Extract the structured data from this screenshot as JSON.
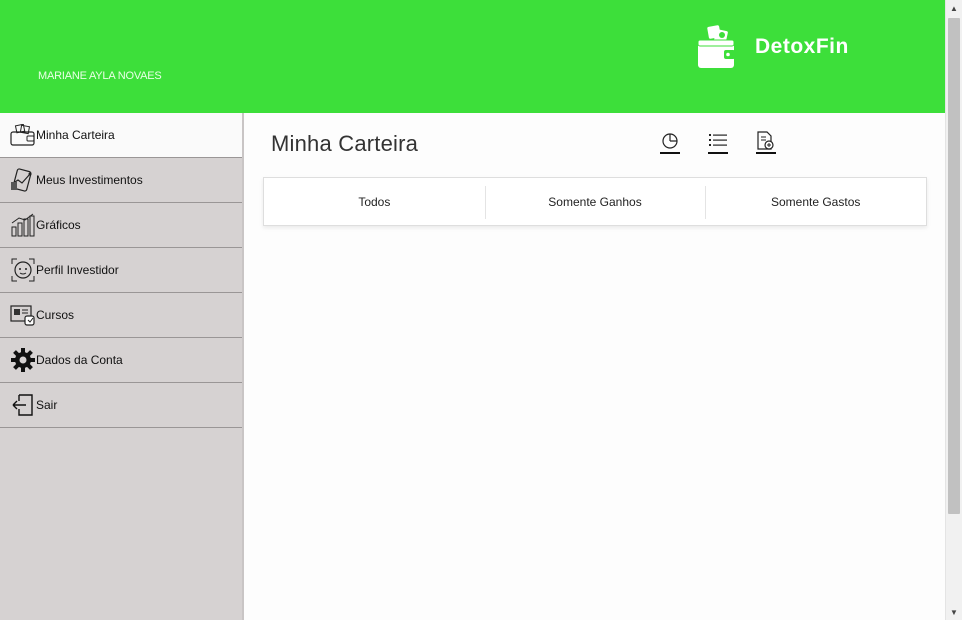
{
  "header": {
    "user_name": "MARIANE AYLA NOVAES",
    "brand_name": "DetoxFin",
    "logo_icon": "wallet-icon",
    "bg_color": "#3ddf3a"
  },
  "sidebar": {
    "items": [
      {
        "label": "Minha Carteira",
        "icon": "wallet-icon",
        "active": true
      },
      {
        "label": "Meus Investimentos",
        "icon": "investments-icon",
        "active": false
      },
      {
        "label": "Gráficos",
        "icon": "bar-chart-icon",
        "active": false
      },
      {
        "label": "Perfil Investidor",
        "icon": "face-profile-icon",
        "active": false
      },
      {
        "label": "Cursos",
        "icon": "courses-icon",
        "active": false
      },
      {
        "label": "Dados da Conta",
        "icon": "gear-icon",
        "active": false
      },
      {
        "label": "Sair",
        "icon": "logout-icon",
        "active": false
      }
    ]
  },
  "main": {
    "title": "Minha Carteira",
    "view_icons": [
      "pie-chart-icon",
      "list-icon",
      "add-document-icon"
    ],
    "filters": [
      "Todos",
      "Somente Ganhos",
      "Somente Gastos"
    ]
  }
}
